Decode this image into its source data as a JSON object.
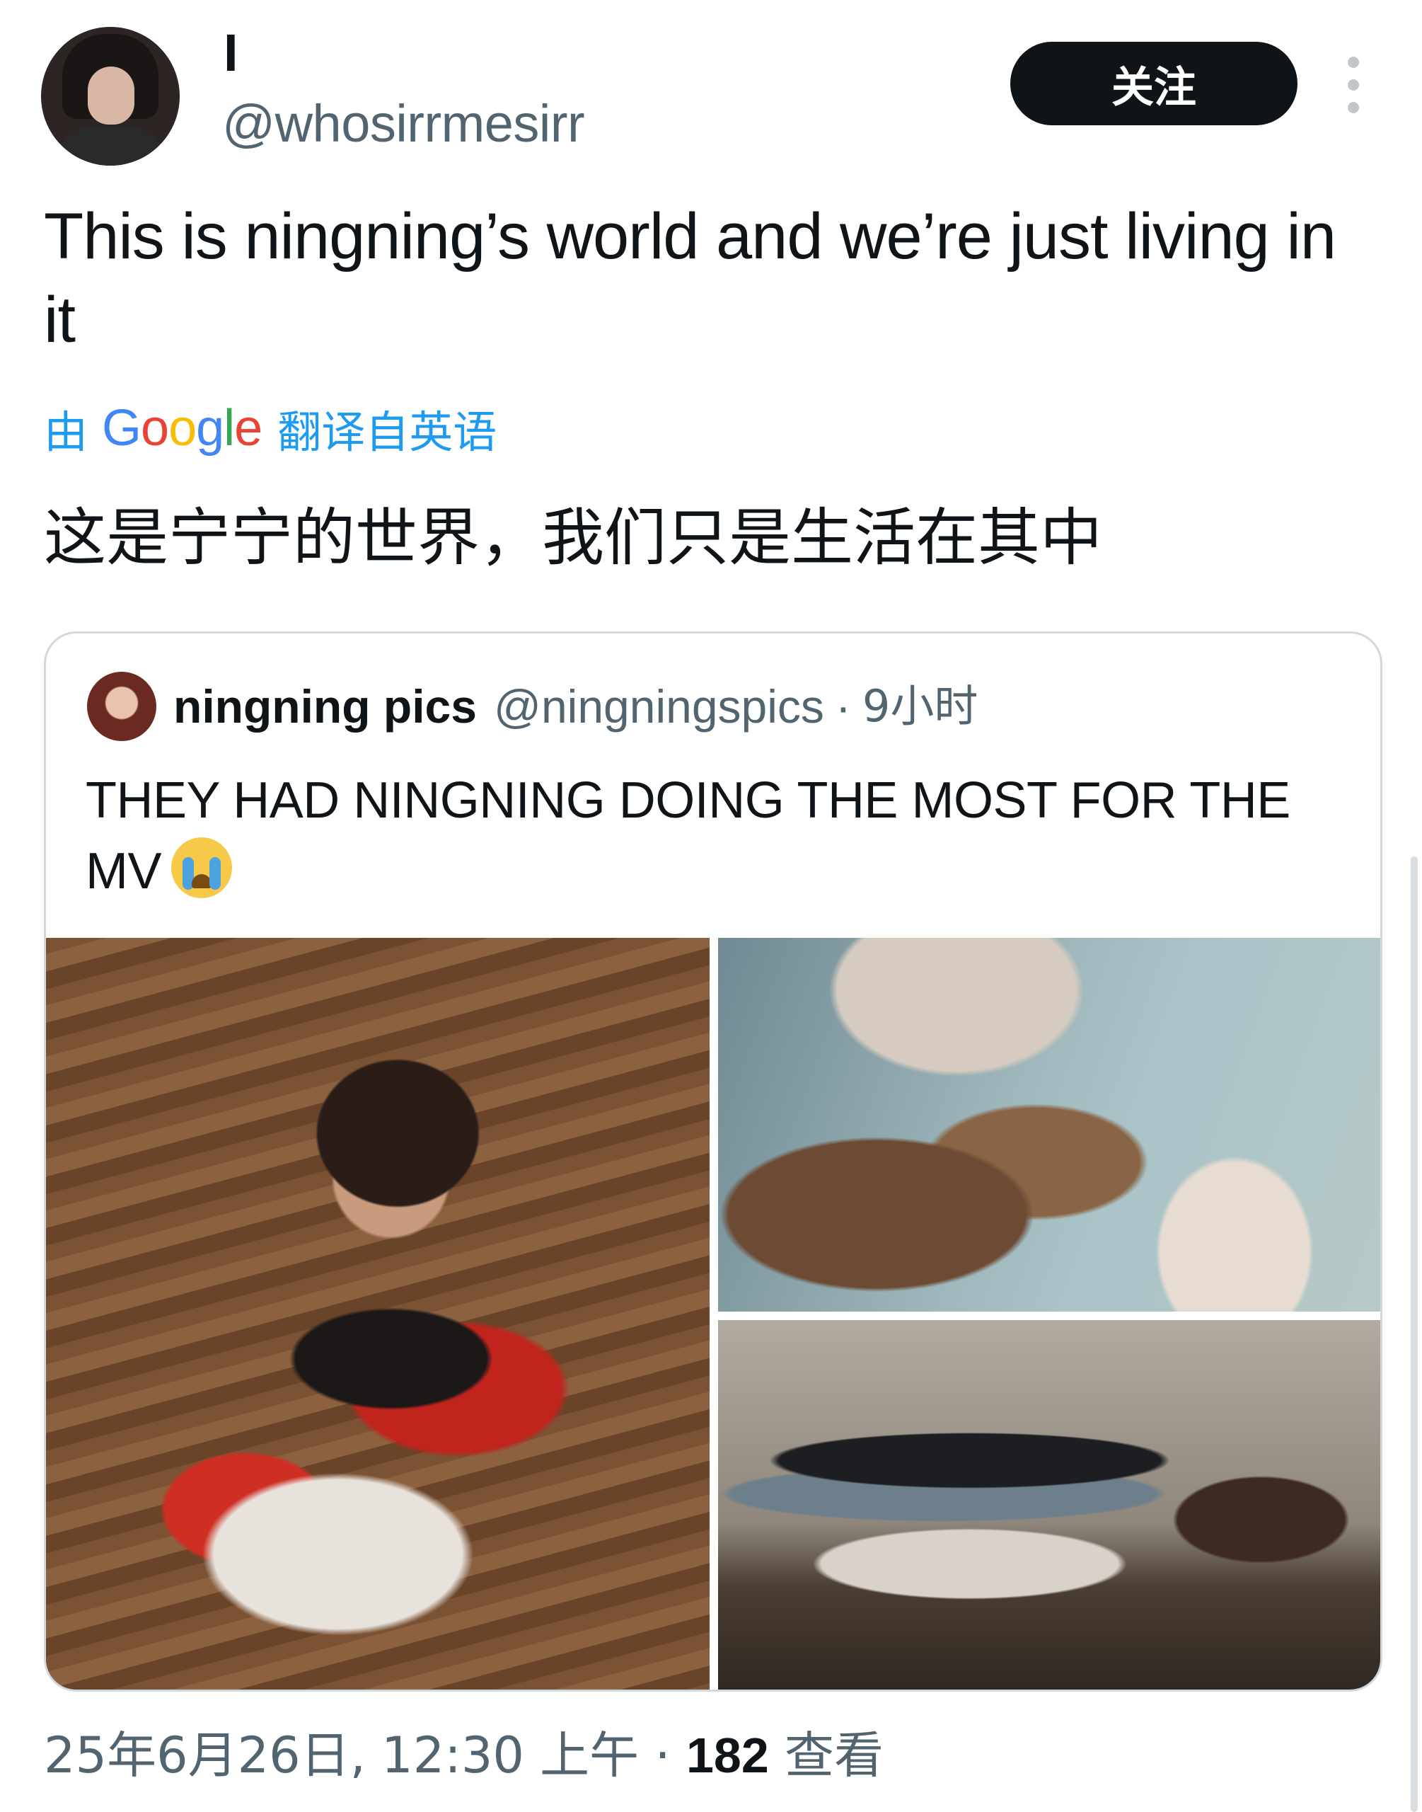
{
  "author": {
    "display_name": "I",
    "handle": "@whosirrmesirr",
    "avatar_icon": "user-avatar"
  },
  "follow_label": "关注",
  "more_icon": "vertical-ellipsis-icon",
  "tweet_text": "This is ningning’s world and we’re just living in it",
  "translation": {
    "prefix": "由",
    "provider": "Google",
    "suffix": "翻译自英语",
    "text": "这是宁宁的世界，我们只是生活在其中"
  },
  "quoted_tweet": {
    "display_name": "ningning pics",
    "handle": "@ningningspics",
    "separator": "·",
    "time": "9小时",
    "text": "THEY HAD NINGNING DOING THE MOST FOR THE MV",
    "emoji": "loudly-crying-face",
    "photo_count": 3
  },
  "footer": {
    "timestamp": "25年6月26日, 12:30 上午",
    "separator": "·",
    "views_count": "182",
    "views_label": "查看"
  },
  "colors": {
    "text": "#0f1419",
    "muted": "#536471",
    "link": "#1d9bf0",
    "border": "#cfd9de"
  }
}
